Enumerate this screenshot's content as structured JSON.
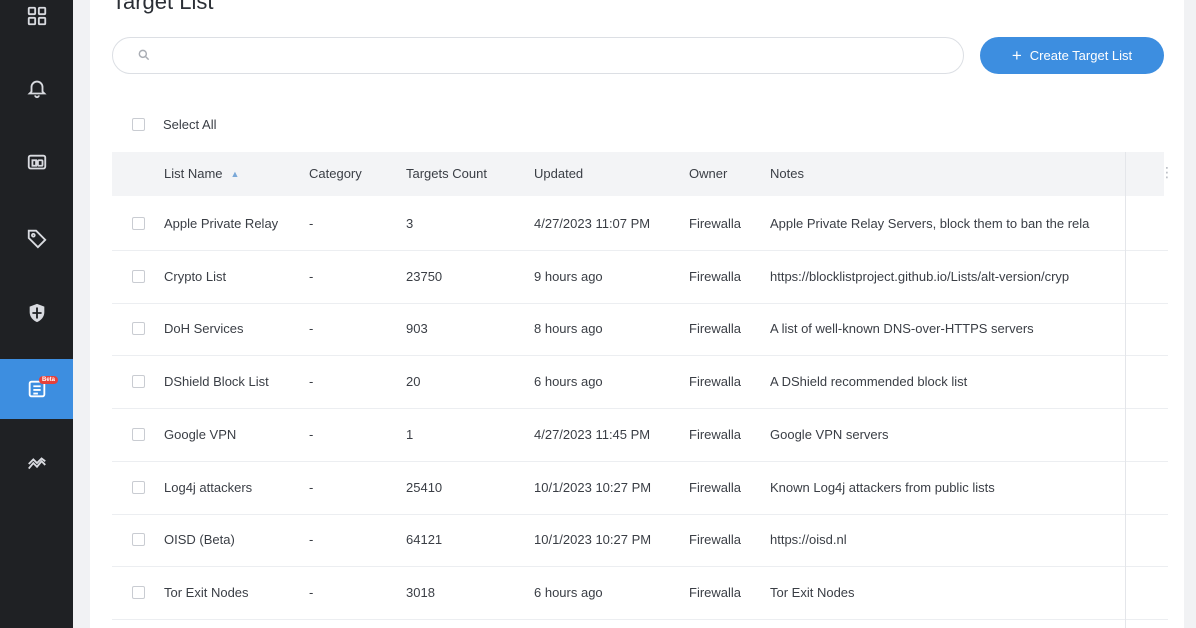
{
  "sidebar": {
    "items": [
      {
        "icon": "dashboard-icon"
      },
      {
        "icon": "bell-icon"
      },
      {
        "icon": "devices-icon"
      },
      {
        "icon": "tag-icon"
      },
      {
        "icon": "shield-icon"
      },
      {
        "icon": "target-list-icon",
        "badge": "Beta",
        "active": true
      },
      {
        "icon": "network-flow-icon"
      }
    ]
  },
  "page": {
    "title": "Target List"
  },
  "search": {
    "value": "",
    "placeholder": ""
  },
  "toolbar": {
    "create_label": "Create Target List"
  },
  "select_all": {
    "label": "Select All"
  },
  "table": {
    "headers": {
      "name": "List Name",
      "category": "Category",
      "count": "Targets Count",
      "updated": "Updated",
      "owner": "Owner",
      "notes": "Notes"
    },
    "rows": [
      {
        "name": "Apple Private Relay",
        "category": "-",
        "count": "3",
        "updated": "4/27/2023 11:07 PM",
        "owner": "Firewalla",
        "notes": "Apple Private Relay Servers, block them to ban the rela"
      },
      {
        "name": "Crypto List",
        "category": "-",
        "count": "23750",
        "updated": "9 hours ago",
        "owner": "Firewalla",
        "notes": "https://blocklistproject.github.io/Lists/alt-version/cryp"
      },
      {
        "name": "DoH Services",
        "category": "-",
        "count": "903",
        "updated": "8 hours ago",
        "owner": "Firewalla",
        "notes": "A list of well-known DNS-over-HTTPS servers"
      },
      {
        "name": "DShield Block List",
        "category": "-",
        "count": "20",
        "updated": "6 hours ago",
        "owner": "Firewalla",
        "notes": "A DShield recommended block list"
      },
      {
        "name": "Google VPN",
        "category": "-",
        "count": "1",
        "updated": "4/27/2023 11:45 PM",
        "owner": "Firewalla",
        "notes": "Google VPN servers"
      },
      {
        "name": "Log4j attackers",
        "category": "-",
        "count": "25410",
        "updated": "10/1/2023 10:27 PM",
        "owner": "Firewalla",
        "notes": "Known Log4j attackers from public lists"
      },
      {
        "name": "OISD (Beta)",
        "category": "-",
        "count": "64121",
        "updated": "10/1/2023 10:27 PM",
        "owner": "Firewalla",
        "notes": "https://oisd.nl"
      },
      {
        "name": "Tor Exit Nodes",
        "category": "-",
        "count": "3018",
        "updated": "6 hours ago",
        "owner": "Firewalla",
        "notes": "Tor Exit Nodes"
      }
    ]
  },
  "colors": {
    "accent": "#3d8ee0",
    "sidebar_bg": "#1f2124",
    "badge": "#e6413b"
  }
}
